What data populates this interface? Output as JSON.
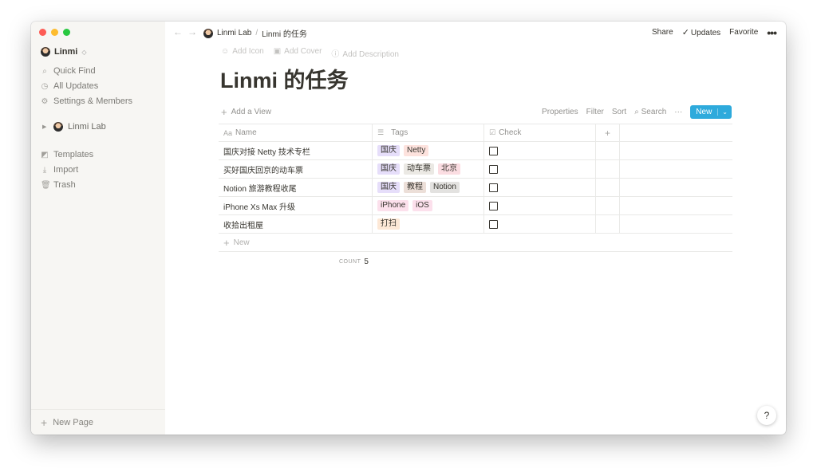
{
  "sidebar": {
    "workspace_name": "Linmi",
    "workspace_caret": "◇",
    "items": [
      {
        "label": "Quick Find",
        "icon": "search-icon"
      },
      {
        "label": "All Updates",
        "icon": "clock-icon"
      },
      {
        "label": "Settings & Members",
        "icon": "gear-icon"
      }
    ],
    "page": {
      "label": "Linmi Lab"
    },
    "tools": [
      {
        "label": "Templates",
        "icon": "templates-icon"
      },
      {
        "label": "Import",
        "icon": "import-icon"
      },
      {
        "label": "Trash",
        "icon": "trash-icon"
      }
    ],
    "new_page": "New Page"
  },
  "topbar": {
    "breadcrumb_root": "Linmi Lab",
    "breadcrumb_sep": "/",
    "breadcrumb_page": "Linmi 的任务",
    "share": "Share",
    "updates": "Updates",
    "favorite": "Favorite"
  },
  "page": {
    "add_icon": "Add Icon",
    "add_cover": "Add Cover",
    "add_description": "Add Description",
    "title": "Linmi 的任务"
  },
  "view": {
    "add_view": "Add a View",
    "properties": "Properties",
    "filter": "Filter",
    "sort": "Sort",
    "search": "Search",
    "new": "New"
  },
  "table": {
    "columns": [
      {
        "label": "Name",
        "icon": "Aa"
      },
      {
        "label": "Tags",
        "icon": "☰"
      },
      {
        "label": "Check",
        "icon": "☑"
      }
    ],
    "rows": [
      {
        "name": "国庆对接 Netty 技术专栏",
        "tags": [
          {
            "label": "国庆",
            "color": "#e6defa"
          },
          {
            "label": "Netty",
            "color": "#fde2dd"
          }
        ],
        "checked": false
      },
      {
        "name": "买好国庆回京的动车票",
        "tags": [
          {
            "label": "国庆",
            "color": "#e6defa"
          },
          {
            "label": "动车票",
            "color": "#ebe9e4"
          },
          {
            "label": "北京",
            "color": "#fbdde2"
          }
        ],
        "checked": false
      },
      {
        "name": "Notion 旅游教程收尾",
        "tags": [
          {
            "label": "国庆",
            "color": "#e6defa"
          },
          {
            "label": "教程",
            "color": "#ecdfd8"
          },
          {
            "label": "Notion",
            "color": "#e3e2e0"
          }
        ],
        "checked": false
      },
      {
        "name": "iPhone Xs Max 升级",
        "tags": [
          {
            "label": "iPhone",
            "color": "#fce0ec"
          },
          {
            "label": "iOS",
            "color": "#fce0ec"
          }
        ],
        "checked": false
      },
      {
        "name": "收拾出租屋",
        "tags": [
          {
            "label": "打扫",
            "color": "#fde8d6"
          }
        ],
        "checked": false
      }
    ],
    "add_row": "New",
    "count_label": "COUNT",
    "count_value": "5"
  },
  "help": "?"
}
